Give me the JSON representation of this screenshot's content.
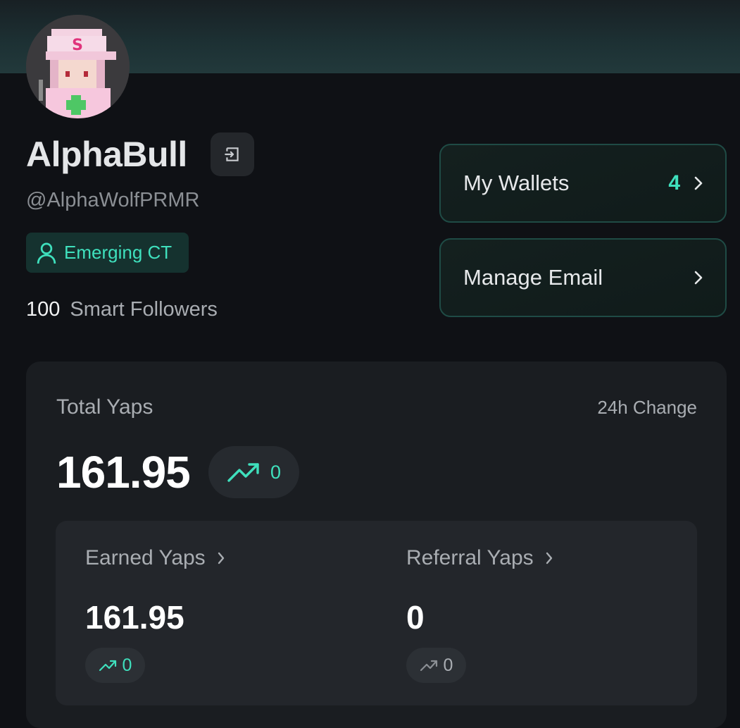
{
  "profile": {
    "display_name": "AlphaBull",
    "handle": "@AlphaWolfPRMR",
    "tier": "Emerging CT",
    "smart_followers_count": "100",
    "smart_followers_label": "Smart Followers"
  },
  "side_buttons": {
    "wallets_label": "My Wallets",
    "wallets_count": "4",
    "email_label": "Manage Email"
  },
  "stats": {
    "total_label": "Total Yaps",
    "change_label": "24h Change",
    "total_value": "161.95",
    "total_change": "0",
    "earned": {
      "label": "Earned Yaps",
      "value": "161.95",
      "change": "0"
    },
    "referral": {
      "label": "Referral Yaps",
      "value": "0",
      "change": "0"
    }
  },
  "colors": {
    "accent": "#3fe0bd",
    "background": "#0f1115",
    "card": "#1a1d21",
    "muted_text": "#a9adb2"
  },
  "icons": [
    "logout-icon",
    "user-icon",
    "chevron-right-icon",
    "trend-up-icon"
  ]
}
